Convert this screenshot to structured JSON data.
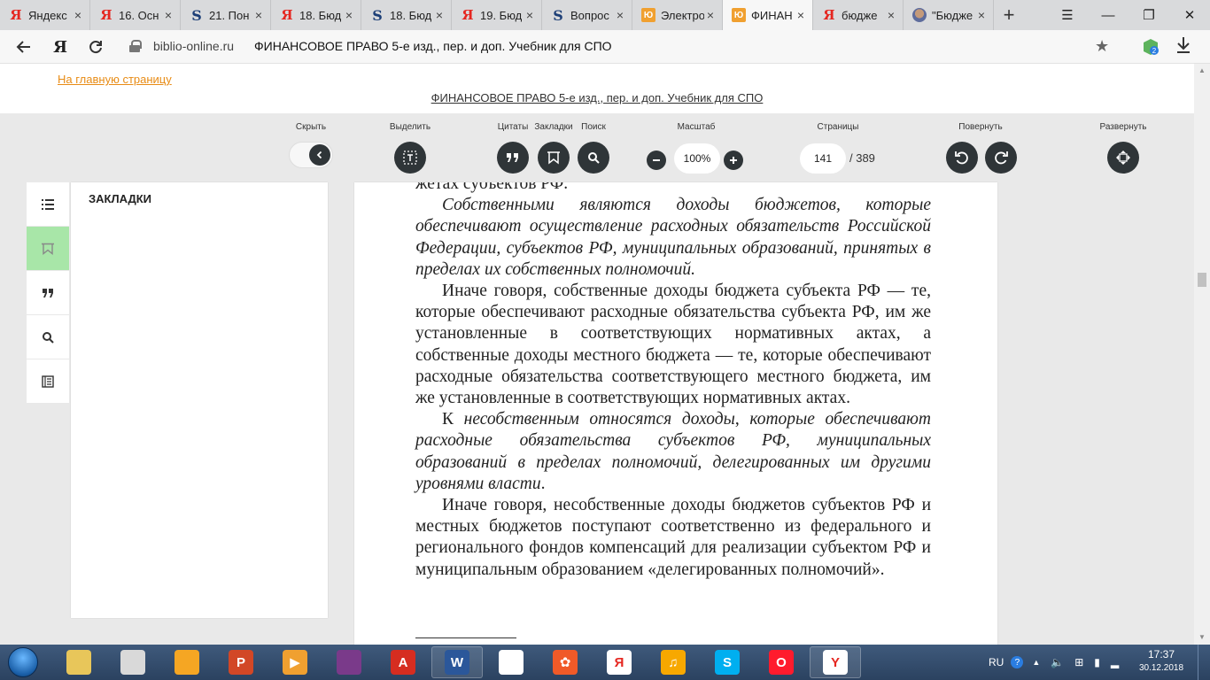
{
  "browser": {
    "tabs": [
      {
        "icon": "yandex-icon",
        "glyph": "Я",
        "title": "Яндекс"
      },
      {
        "icon": "yandex-icon",
        "glyph": "Я",
        "title": "16. Осн"
      },
      {
        "icon": "studfiles-icon",
        "glyph": "S",
        "title": "21. Пон"
      },
      {
        "icon": "yandex-icon",
        "glyph": "Я",
        "title": "18. Бюд"
      },
      {
        "icon": "studfiles-icon",
        "glyph": "S",
        "title": "18. Бюд"
      },
      {
        "icon": "yandex-icon",
        "glyph": "Я",
        "title": "19. Бюд"
      },
      {
        "icon": "studfiles-icon",
        "glyph": "S",
        "title": "Вопрос"
      },
      {
        "icon": "urait-icon",
        "glyph": "Ю",
        "title": "Электро"
      },
      {
        "icon": "urait-icon",
        "glyph": "Ю",
        "title": "ФИНАН",
        "active": true
      },
      {
        "icon": "yandex-icon",
        "glyph": "Я",
        "title": "бюдже"
      },
      {
        "icon": "image-favicon-icon",
        "glyph": "",
        "title": "\"Бюдже"
      }
    ],
    "tab_close": "×",
    "new_tab": "+",
    "address": {
      "domain": "biblio-online.ru",
      "title": "ФИНАНСОВОЕ ПРАВО 5-е изд., пер. и доп. Учебник для СПО"
    }
  },
  "page": {
    "home_link": "На главную страницу",
    "book_link": "ФИНАНСОВОЕ ПРАВО 5-е изд., пер. и доп. Учебник для СПО"
  },
  "toolbar": {
    "hide": "Скрыть",
    "select": "Выделить",
    "quotes": "Цитаты",
    "bookmarks": "Закладки",
    "search": "Поиск",
    "zoom_label": "Масштаб",
    "zoom_value": "100%",
    "pages_label": "Страницы",
    "current_page": "141",
    "total_pages": "/ 389",
    "rotate": "Повернуть",
    "expand": "Развернуть"
  },
  "panel": {
    "title": "ЗАКЛАДКИ"
  },
  "document": {
    "paragraphs": [
      {
        "noindent": true,
        "html": "жетах субъектов РФ."
      },
      {
        "html": "<em>Собственными являются доходы бюджетов, которые обеспечивают осуществление расходных обязательств Российской Федерации, субъектов РФ, муниципальных образований, принятых в пределах их собственных полномочий.</em>"
      },
      {
        "html": "Иначе говоря, собственные доходы бюджета субъекта РФ — те, которые обеспечивают расходные обязательства субъекта РФ, им же установленные в соответствующих нормативных актах, а собственные доходы местного бюджета — те, которые обеспечивают расходные обязательства соответствующего местного бюджета, им же установленные в соответствующих нормативных актах."
      },
      {
        "html": "К <em>несобственным относятся доходы</em>, <em>которые обеспечивают расходные обязательства субъектов РФ, муниципальных образований в пределах полномочий, делегированных им другими уровнями власти</em>."
      },
      {
        "html": "Иначе говоря, несобственные доходы бюджетов субъектов РФ и местных бюджетов поступают соответственно из федерального и регионального фондов компенсаций для реализации субъектом РФ и муниципальным образованием «делегированных полномочий»."
      }
    ]
  },
  "taskbar": {
    "apps": [
      {
        "name": "explorer",
        "color": "#e8c65a",
        "glyph": ""
      },
      {
        "name": "browser-round",
        "color": "#d9d9d9",
        "glyph": ""
      },
      {
        "name": "smiley",
        "color": "#f5a623",
        "glyph": ""
      },
      {
        "name": "powerpoint",
        "color": "#d24726",
        "glyph": "P"
      },
      {
        "name": "media-player",
        "color": "#f0a030",
        "glyph": "▶"
      },
      {
        "name": "winrar",
        "color": "#7a3a8a",
        "glyph": ""
      },
      {
        "name": "pdf-reader",
        "color": "#d62d20",
        "glyph": "A"
      },
      {
        "name": "word",
        "color": "#2b579a",
        "glyph": "W",
        "open": true
      },
      {
        "name": "grid-app",
        "color": "#ffffff",
        "glyph": ""
      },
      {
        "name": "film-app",
        "color": "#f05a28",
        "glyph": "✿"
      },
      {
        "name": "yandex-app",
        "color": "#ffffff",
        "glyph": "Я"
      },
      {
        "name": "audio-app",
        "color": "#f7a800",
        "glyph": "♫"
      },
      {
        "name": "skype",
        "color": "#00aff0",
        "glyph": "S"
      },
      {
        "name": "opera",
        "color": "#ff1b2d",
        "glyph": "O"
      },
      {
        "name": "yandex-browser",
        "color": "#ffffff",
        "glyph": "Y",
        "open": true
      }
    ],
    "lang": "RU",
    "time": "17:37",
    "date": "30.12.2018"
  }
}
